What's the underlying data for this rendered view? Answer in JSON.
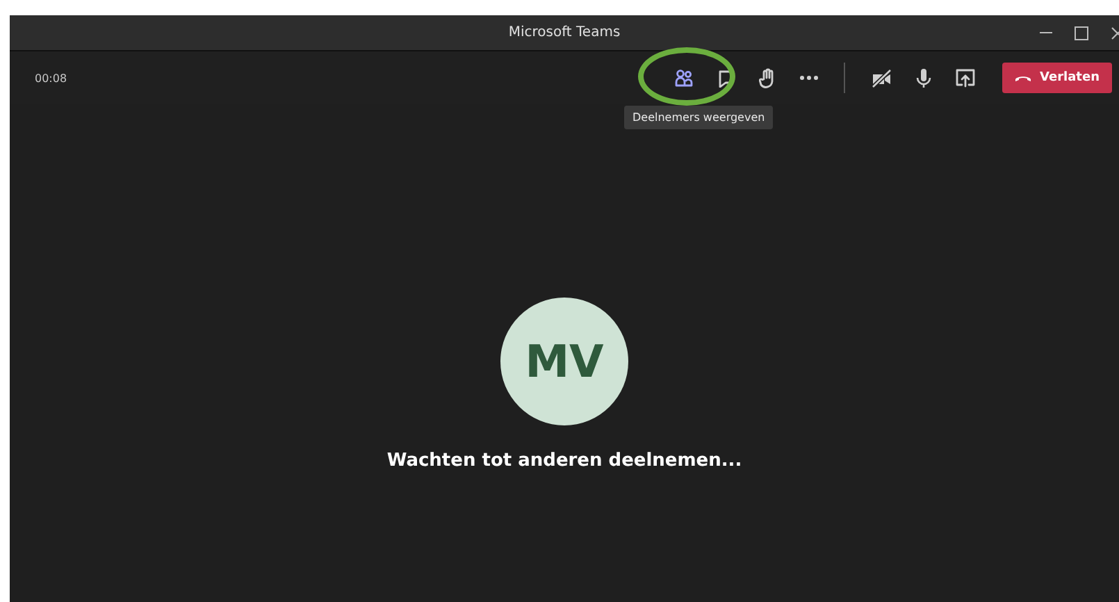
{
  "window": {
    "title": "Microsoft Teams"
  },
  "call": {
    "timer": "00:08",
    "controls": [
      {
        "kind": "participants",
        "hovered": true
      },
      {
        "kind": "chat",
        "hovered": false
      },
      {
        "kind": "hand",
        "hovered": false
      },
      {
        "kind": "more",
        "hovered": false
      },
      {
        "kind": "separator"
      },
      {
        "kind": "camera",
        "on": false
      },
      {
        "kind": "mic",
        "on": true
      },
      {
        "kind": "share",
        "hovered": false
      }
    ],
    "leave_button": "Verlaten",
    "tooltip": "Deelnemers weergeven"
  },
  "stage": {
    "avatar_initials": "MV",
    "status": "Wachten tot anderen deelnemen..."
  }
}
